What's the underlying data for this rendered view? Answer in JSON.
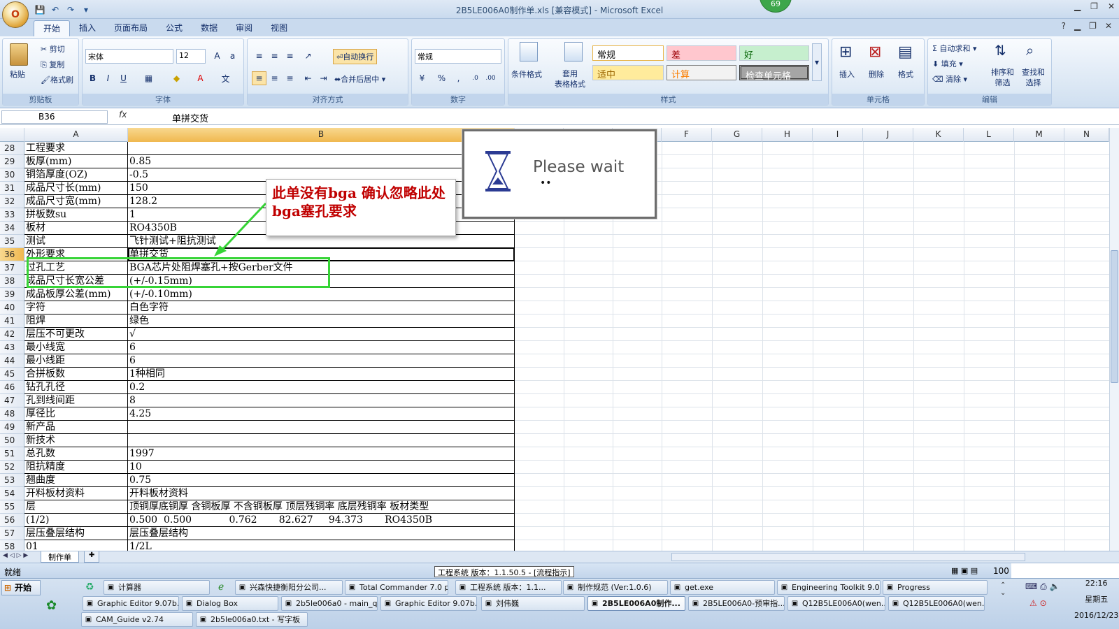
{
  "window": {
    "title": "2B5LE006A0制作单.xls  [兼容模式] - Microsoft Excel",
    "office_button": "O",
    "badge": "69"
  },
  "qat": {
    "save": "💾",
    "undo": "↶",
    "redo": "↷",
    "more": "▾"
  },
  "tabs": [
    "开始",
    "插入",
    "页面布局",
    "公式",
    "数据",
    "审阅",
    "视图"
  ],
  "ribbon": {
    "clipboard": {
      "label": "剪贴板",
      "paste": "粘贴",
      "cut": "剪切",
      "copy": "复制",
      "format_painter": "格式刷"
    },
    "font": {
      "label": "字体",
      "name": "宋体",
      "size": "12",
      "bold": "B",
      "italic": "I",
      "underline": "U"
    },
    "alignment": {
      "label": "对齐方式",
      "wrap": "自动换行",
      "merge": "合并后居中"
    },
    "number": {
      "label": "数字",
      "format": "常规",
      "percent": "%",
      "comma": ","
    },
    "styles": {
      "label": "样式",
      "conditional": "条件格式",
      "table": "套用\n表格格式",
      "normal": "常规",
      "bad": "差",
      "good": "好",
      "neutral": "适中",
      "calc": "计算",
      "check": "检查单元格"
    },
    "cells": {
      "label": "单元格",
      "insert": "插入",
      "delete": "删除",
      "format": "格式"
    },
    "editing": {
      "label": "编辑",
      "autosum": "自动求和",
      "fill": "填充",
      "clear": "清除",
      "sort": "排序和\n筛选",
      "find": "查找和\n选择"
    }
  },
  "formula_bar": {
    "name_box": "B36",
    "fx": "fx",
    "value": "单拼交货"
  },
  "columns": [
    "A",
    "B",
    "C",
    "D",
    "E",
    "F",
    "G",
    "H",
    "I",
    "J",
    "K",
    "L",
    "M",
    "N"
  ],
  "rows": [
    {
      "n": "28",
      "a": "工程要求",
      "b": ""
    },
    {
      "n": "29",
      "a": "板厚(mm)",
      "b": "0.85"
    },
    {
      "n": "30",
      "a": "铜箔厚度(OZ)",
      "b": "-0.5"
    },
    {
      "n": "31",
      "a": "成品尺寸长(mm)",
      "b": "150"
    },
    {
      "n": "32",
      "a": "成品尺寸宽(mm)",
      "b": "128.2"
    },
    {
      "n": "33",
      "a": "拼板数su",
      "b": "1"
    },
    {
      "n": "34",
      "a": "板材",
      "b": "RO4350B"
    },
    {
      "n": "35",
      "a": "测试",
      "b": "飞针测试+阻抗测试"
    },
    {
      "n": "36",
      "a": "外形要求",
      "b": "单拼交货"
    },
    {
      "n": "37",
      "a": "过孔工艺",
      "b": "BGA芯片处阻焊塞孔+按Gerber文件"
    },
    {
      "n": "38",
      "a": "成品尺寸长宽公差",
      "b": "(+/-0.15mm)"
    },
    {
      "n": "39",
      "a": "成品板厚公差(mm)",
      "b": "(+/-0.10mm)"
    },
    {
      "n": "40",
      "a": "字符",
      "b": "白色字符"
    },
    {
      "n": "41",
      "a": "阻焊",
      "b": "绿色"
    },
    {
      "n": "42",
      "a": "层压不可更改",
      "b": "√"
    },
    {
      "n": "43",
      "a": "最小线宽",
      "b": "6"
    },
    {
      "n": "44",
      "a": "最小线距",
      "b": "6"
    },
    {
      "n": "45",
      "a": "合拼板数",
      "b": "1种相同"
    },
    {
      "n": "46",
      "a": "钻孔孔径",
      "b": "0.2"
    },
    {
      "n": "47",
      "a": "孔到线间距",
      "b": "8"
    },
    {
      "n": "48",
      "a": "厚径比",
      "b": "4.25"
    },
    {
      "n": "49",
      "a": "新产品",
      "b": ""
    },
    {
      "n": "50",
      "a": "新技术",
      "b": ""
    },
    {
      "n": "51",
      "a": "总孔数",
      "b": "1997"
    },
    {
      "n": "52",
      "a": "阻抗精度",
      "b": "10"
    },
    {
      "n": "53",
      "a": "翘曲度",
      "b": "0.75"
    },
    {
      "n": "54",
      "a": "开料板材资料",
      "b": "开料板材资料"
    },
    {
      "n": "55",
      "a": "层",
      "b": "顶铜厚底铜厚 含铜板厚 不含铜板厚 顶层残铜率 底层残铜率 板材类型"
    },
    {
      "n": "56",
      "a": "(1/2)",
      "b": "0.500  0.500            0.762       82.627     94.373       RO4350B"
    },
    {
      "n": "57",
      "a": "层压叠层结构",
      "b": "层压叠层结构"
    },
    {
      "n": "58",
      "a": "01",
      "b": "1/2L"
    }
  ],
  "annotation": {
    "text": "此单没有bga  确认忽略此处bga塞孔要求",
    "color": "#c00000",
    "highlight_color": "#36d436"
  },
  "wait_dialog": {
    "text": "Please wait",
    "dots": "••"
  },
  "sheet_tabs": {
    "active": "制作单"
  },
  "status": {
    "ready": "就绪",
    "app_info": "工程系统  版本：1.1.50.5 - [流程指示]",
    "zoom": "100"
  },
  "taskbar": {
    "start": "开始",
    "row1": [
      "计算器",
      "兴森快捷衡阳分公司...",
      "Total Commander 7.0 p...",
      "工程系统  版本：1.1...",
      "制作规范 (Ver:1.0.6)",
      "get.exe",
      "Engineering Toolkit 9.0...",
      "Progress"
    ],
    "row2": [
      "Graphic Editor 9.07b...",
      "Dialog Box",
      "2b5le006a0 - main_qa",
      "Graphic Editor 9.07b...",
      "刘伟巍",
      "2B5LE006A0制作...",
      "2B5LE006A0-预审指...",
      "Q12B5LE006A0(wen...",
      "Q12B5LE006A0(wen..."
    ],
    "row3": [
      "CAM_Guide v2.74",
      "2b5le006a0.txt - 写字板"
    ],
    "clock": {
      "time": "22:16",
      "weekday": "星期五",
      "date": "2016/12/23"
    }
  }
}
